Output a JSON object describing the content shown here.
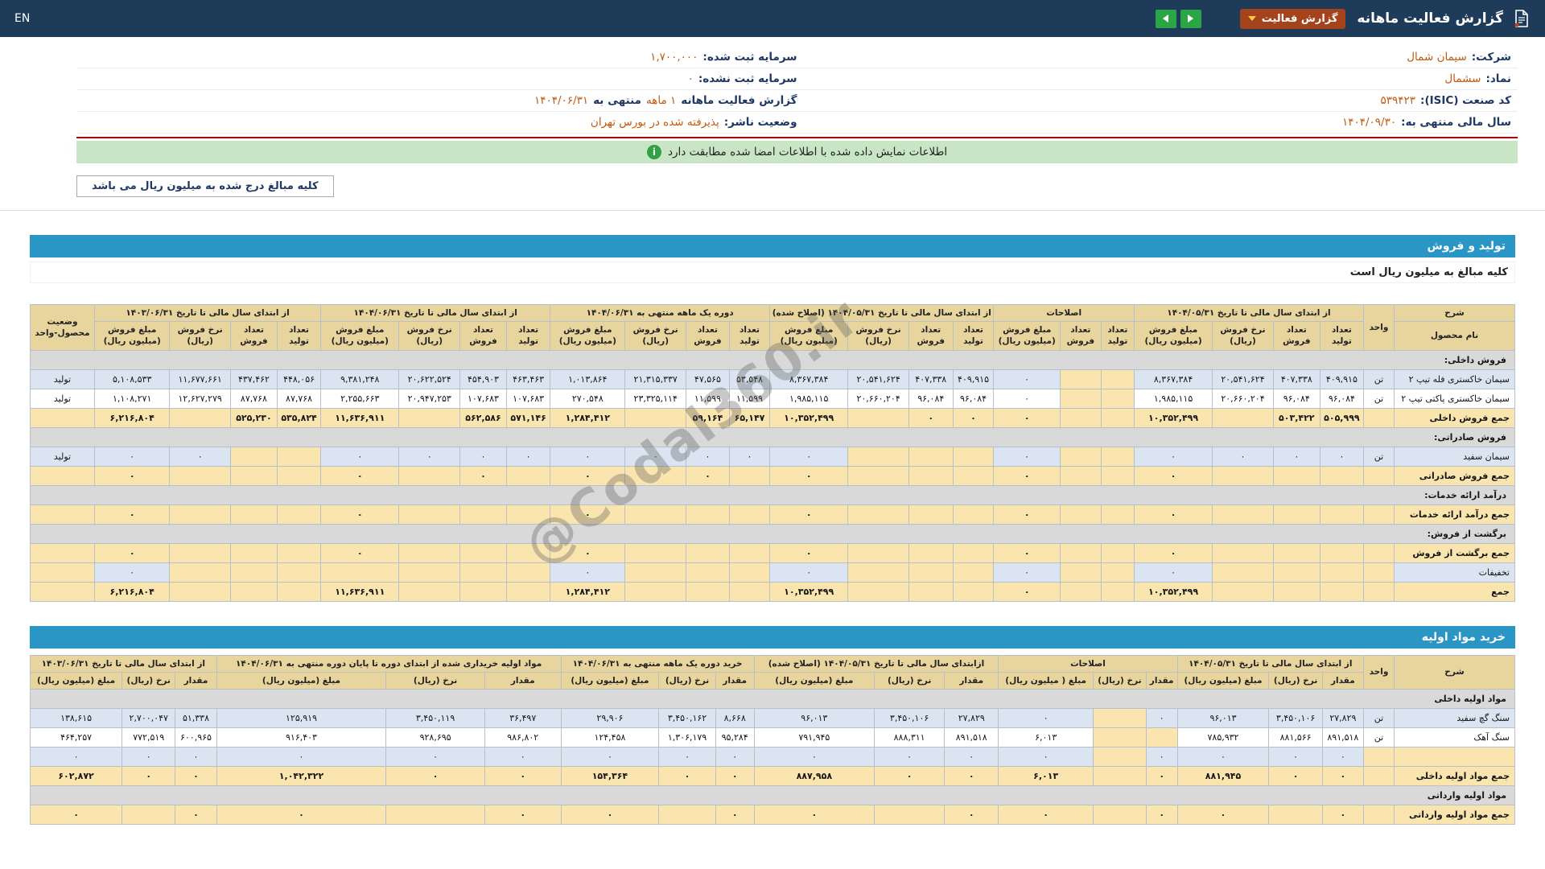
{
  "navbar": {
    "title": "گزارش فعالیت ماهانه",
    "report_type": "گزارش فعالیت",
    "lang": "EN"
  },
  "info": {
    "rows": [
      {
        "r_label": "شرکت:",
        "r_value": "سیمان شمال",
        "l_label": "سرمایه ثبت شده:",
        "l_value": "۱,۷۰۰,۰۰۰"
      },
      {
        "r_label": "نماد:",
        "r_value": "سشمال",
        "l_label": "سرمایه ثبت نشده:",
        "l_value": "۰"
      },
      {
        "r_label": "کد صنعت (ISIC):",
        "r_value": "۵۳۹۴۲۳",
        "l_label": "گزارش فعالیت ماهانه",
        "l_value": "۱ ماهه",
        "l_label2": "منتهی به",
        "l_value2": "۱۴۰۴/۰۶/۳۱"
      },
      {
        "r_label": "سال مالی منتهی به:",
        "r_value": "۱۴۰۴/۰۹/۳۰",
        "l_label": "وضعیت ناشر:",
        "l_value": "پذیرفته شده در بورس تهران"
      }
    ]
  },
  "notice": {
    "icon_glyph": "i",
    "text": "اطلاعات نمایش داده شده با اطلاعات امضا شده مطابقت دارد"
  },
  "amounts_note": "کلیه مبالغ درج شده به میلیون ریال می باشد",
  "watermark": "@Codal360.ir",
  "colors": {
    "navbar_bg": "#1e3c5a",
    "badge_bg": "#a5431c",
    "caret_yellow": "#ffc83d",
    "arrow_green": "#2aa744",
    "value_orange": "#c05a11",
    "label_navy": "#1f3864",
    "red_line": "#b30000",
    "notice_green": "#c8e6c5",
    "section_bar_blue": "#2a96c6",
    "table_header_tan": "#e8d59d",
    "sum_row_tan": "#fbe5af",
    "row_blue": "#dbe5f1",
    "section_row_gray": "#d9d9d9"
  },
  "production": {
    "bar": "تولید و فروش",
    "note": "کلیه مبالغ به میلیون ریال است",
    "table": {
      "data_name": "production-sales-table",
      "header": {
        "sharh": "شرح",
        "product": "نام محصول",
        "unit": "واحد",
        "status": "وضعیت محصول-واحد",
        "groups": [
          {
            "title": "از ابتدای سال مالی تا تاریخ ۱۴۰۴/۰۵/۳۱",
            "cols": [
              "تعداد تولید",
              "تعداد فروش",
              "نرخ فروش (ریال)",
              "مبلغ فروش (میلیون ریال)"
            ]
          },
          {
            "title": "اصلاحات",
            "cols": [
              "تعداد تولید",
              "تعداد فروش",
              "مبلغ فروش (میلیون ریال)"
            ]
          },
          {
            "title": "از ابتدای سال مالی تا تاریخ ۱۴۰۴/۰۵/۳۱ (اصلاح شده)",
            "cols": [
              "تعداد تولید",
              "تعداد فروش",
              "نرخ فروش (ریال)",
              "مبلغ فروش (میلیون ریال)"
            ]
          },
          {
            "title": "دوره یک ماهه منتهی به ۱۴۰۴/۰۶/۳۱",
            "cols": [
              "تعداد تولید",
              "تعداد فروش",
              "نرخ فروش (ریال)",
              "مبلغ فروش (میلیون ریال)"
            ]
          },
          {
            "title": "از ابتدای سال مالی تا تاریخ ۱۴۰۴/۰۶/۳۱",
            "cols": [
              "تعداد تولید",
              "تعداد فروش",
              "نرخ فروش (ریال)",
              "مبلغ فروش (میلیون ریال)"
            ]
          },
          {
            "title": "از ابتدای سال مالی تا تاریخ ۱۴۰۳/۰۶/۳۱",
            "cols": [
              "تعداد تولید",
              "تعداد فروش",
              "نرخ فروش (ریال)",
              "مبلغ فروش (میلیون ریال)"
            ]
          }
        ]
      },
      "rows": [
        {
          "type": "section",
          "label": "فروش داخلی:"
        },
        {
          "type": "data",
          "style": "blue",
          "label": "سیمان خاکستری فله تیپ ۲",
          "unit": "تن",
          "status": "تولید",
          "cells": [
            "۴۰۹,۹۱۵",
            "۴۰۷,۳۳۸",
            "۲۰,۵۴۱,۶۲۴",
            "۸,۳۶۷,۳۸۴",
            "",
            "",
            "۰",
            "۴۰۹,۹۱۵",
            "۴۰۷,۳۳۸",
            "۲۰,۵۴۱,۶۲۴",
            "۸,۳۶۷,۳۸۴",
            "۵۳,۵۴۸",
            "۴۷,۵۶۵",
            "۲۱,۳۱۵,۳۳۷",
            "۱,۰۱۳,۸۶۴",
            "۴۶۳,۴۶۳",
            "۴۵۴,۹۰۳",
            "۲۰,۶۲۲,۵۲۴",
            "۹,۳۸۱,۲۴۸",
            "۴۴۸,۰۵۶",
            "۴۳۷,۴۶۲",
            "۱۱,۶۷۷,۶۶۱",
            "۵,۱۰۸,۵۳۳"
          ]
        },
        {
          "type": "data",
          "style": "white",
          "label": "سیمان خاکستری پاکتی تیپ ۲",
          "unit": "تن",
          "status": "تولید",
          "cells": [
            "۹۶,۰۸۴",
            "۹۶,۰۸۴",
            "۲۰,۶۶۰,۲۰۴",
            "۱,۹۸۵,۱۱۵",
            "",
            "",
            "۰",
            "۹۶,۰۸۴",
            "۹۶,۰۸۴",
            "۲۰,۶۶۰,۲۰۴",
            "۱,۹۸۵,۱۱۵",
            "۱۱,۵۹۹",
            "۱۱,۵۹۹",
            "۲۳,۳۲۵,۱۱۴",
            "۲۷۰,۵۴۸",
            "۱۰۷,۶۸۳",
            "۱۰۷,۶۸۳",
            "۲۰,۹۴۷,۲۵۳",
            "۲,۲۵۵,۶۶۳",
            "۸۷,۷۶۸",
            "۸۷,۷۶۸",
            "۱۲,۶۲۷,۲۷۹",
            "۱,۱۰۸,۲۷۱"
          ]
        },
        {
          "type": "data",
          "style": "sum",
          "label": "جمع فروش داخلی",
          "unit": "",
          "status": "",
          "cells": [
            "۵۰۵,۹۹۹",
            "۵۰۳,۴۲۲",
            "",
            "۱۰,۳۵۲,۴۹۹",
            "",
            "",
            "۰",
            "۰",
            "۰",
            "",
            "۱۰,۳۵۲,۴۹۹",
            "۶۵,۱۴۷",
            "۵۹,۱۶۴",
            "",
            "۱,۲۸۴,۴۱۲",
            "۵۷۱,۱۴۶",
            "۵۶۲,۵۸۶",
            "",
            "۱۱,۶۳۶,۹۱۱",
            "۵۳۵,۸۲۴",
            "۵۲۵,۲۳۰",
            "",
            "۶,۲۱۶,۸۰۴"
          ]
        },
        {
          "type": "section",
          "label": "فروش صادراتی:"
        },
        {
          "type": "data",
          "style": "blue",
          "label": "سیمان سفید",
          "unit": "تن",
          "status": "تولید",
          "cells": [
            "۰",
            "۰",
            "۰",
            "۰",
            "",
            "",
            "۰",
            "",
            "",
            "",
            "۰",
            "۰",
            "۰",
            "۰",
            "۰",
            "۰",
            "۰",
            "۰",
            "۰",
            "",
            "",
            "۰",
            "۰"
          ]
        },
        {
          "type": "data",
          "style": "sum",
          "label": "جمع فروش صادراتی",
          "unit": "",
          "status": "",
          "cells": [
            "",
            "",
            "",
            "۰",
            "",
            "",
            "۰",
            "",
            "",
            "",
            "۰",
            "",
            "۰",
            "",
            "۰",
            "",
            "۰",
            "",
            "۰",
            "",
            "",
            "",
            "۰"
          ]
        },
        {
          "type": "section",
          "label": "درآمد ارائه خدمات:"
        },
        {
          "type": "data",
          "style": "sum",
          "label": "جمع درآمد ارائه خدمات",
          "unit": "",
          "status": "",
          "cells": [
            "",
            "",
            "",
            "۰",
            "",
            "",
            "۰",
            "",
            "",
            "",
            "۰",
            "",
            "",
            "",
            "۰",
            "",
            "",
            "",
            "۰",
            "",
            "",
            "",
            "۰"
          ]
        },
        {
          "type": "section",
          "label": "برگشت از فروش:"
        },
        {
          "type": "data",
          "style": "sum",
          "label": "جمع برگشت از فروش",
          "unit": "",
          "status": "",
          "cells": [
            "",
            "",
            "",
            "۰",
            "",
            "",
            "۰",
            "",
            "",
            "",
            "۰",
            "",
            "",
            "",
            "۰",
            "",
            "",
            "",
            "۰",
            "",
            "",
            "",
            "۰"
          ]
        },
        {
          "type": "data",
          "style": "blue",
          "label": "تخفیفات",
          "unit": "",
          "status": "",
          "cells": [
            "",
            "",
            "",
            "۰",
            "",
            "",
            "۰",
            "",
            "",
            "",
            "۰",
            "",
            "",
            "",
            "۰",
            "",
            "",
            "",
            "",
            "",
            "",
            "",
            "۰"
          ]
        },
        {
          "type": "data",
          "style": "sum",
          "label": "جمع",
          "unit": "",
          "status": "",
          "cells": [
            "",
            "",
            "",
            "۱۰,۳۵۲,۴۹۹",
            "",
            "",
            "۰",
            "",
            "",
            "",
            "۱۰,۳۵۲,۴۹۹",
            "",
            "",
            "",
            "۱,۲۸۴,۴۱۲",
            "",
            "",
            "",
            "۱۱,۶۳۶,۹۱۱",
            "",
            "",
            "",
            "۶,۲۱۶,۸۰۴"
          ]
        }
      ]
    }
  },
  "materials": {
    "bar": "خرید مواد اولیه",
    "table": {
      "data_name": "materials-purchase-table",
      "header": {
        "sharh": "شرح",
        "unit": "واحد",
        "groups": [
          {
            "title": "از ابتدای سال مالی تا تاریخ ۱۴۰۴/۰۵/۳۱",
            "cols": [
              "مقدار",
              "نرخ (ریال)",
              "مبلغ (میلیون ریال)"
            ]
          },
          {
            "title": "اصلاحات",
            "cols": [
              "مقدار",
              "نرخ (ریال)",
              "مبلغ ( میلیون ریال)"
            ]
          },
          {
            "title": "ازابتدای سال مالی تا تاریخ ۱۴۰۴/۰۵/۳۱ (اصلاح شده)",
            "cols": [
              "مقدار",
              "نرخ (ریال)",
              "مبلغ (میلیون ریال)"
            ]
          },
          {
            "title": "خرید دوره یک ماهه منتهی به ۱۴۰۴/۰۶/۳۱",
            "cols": [
              "مقدار",
              "نرخ (ریال)",
              "مبلغ (میلیون ریال)"
            ]
          },
          {
            "title": "مواد اولیه خریداری شده از ابتدای دوره تا پایان دوره منتهی به ۱۴۰۴/۰۶/۳۱",
            "cols": [
              "مقدار",
              "نرخ (ریال)",
              "مبلغ (میلیون ریال)"
            ]
          },
          {
            "title": "از ابتدای سال مالی تا تاریخ ۱۴۰۳/۰۶/۳۱",
            "cols": [
              "مقدار",
              "نرخ (ریال)",
              "مبلغ (میلیون ریال)"
            ]
          }
        ]
      },
      "rows": [
        {
          "type": "section",
          "label": "مواد اولیه داخلی"
        },
        {
          "type": "data",
          "style": "blue",
          "label": "سنگ گچ سفید",
          "unit": "تن",
          "cells": [
            "۲۷,۸۲۹",
            "۳,۴۵۰,۱۰۶",
            "۹۶,۰۱۳",
            "۰",
            "",
            "۰",
            "۲۷,۸۲۹",
            "۳,۴۵۰,۱۰۶",
            "۹۶,۰۱۳",
            "۸,۶۶۸",
            "۳,۴۵۰,۱۶۲",
            "۲۹,۹۰۶",
            "۳۶,۴۹۷",
            "۳,۴۵۰,۱۱۹",
            "۱۲۵,۹۱۹",
            "۵۱,۳۳۸",
            "۲,۷۰۰,۰۴۷",
            "۱۳۸,۶۱۵"
          ]
        },
        {
          "type": "data",
          "style": "white",
          "label": "سنگ آهک",
          "unit": "تن",
          "cells": [
            "۸۹۱,۵۱۸",
            "۸۸۱,۵۶۶",
            "۷۸۵,۹۳۲",
            "",
            "",
            "۶,۰۱۳",
            "۸۹۱,۵۱۸",
            "۸۸۸,۳۱۱",
            "۷۹۱,۹۴۵",
            "۹۵,۲۸۴",
            "۱,۳۰۶,۱۷۹",
            "۱۲۴,۴۵۸",
            "۹۸۶,۸۰۲",
            "۹۲۸,۶۹۵",
            "۹۱۶,۴۰۳",
            "۶۰۰,۹۶۵",
            "۷۷۲,۵۱۹",
            "۴۶۴,۲۵۷"
          ]
        },
        {
          "type": "data",
          "style": "blue",
          "label": "",
          "unit": "",
          "cells": [
            "۰",
            "۰",
            "۰",
            "۰",
            "",
            "۰",
            "۰",
            "۰",
            "۰",
            "۰",
            "۰",
            "۰",
            "۰",
            "۰",
            "۰",
            "۰",
            "۰",
            "۰"
          ]
        },
        {
          "type": "data",
          "style": "sum",
          "label": "جمع مواد اولیه داخلی",
          "unit": "",
          "cells": [
            "۰",
            "۰",
            "۸۸۱,۹۴۵",
            "۰",
            "",
            "۶,۰۱۳",
            "۰",
            "۰",
            "۸۸۷,۹۵۸",
            "۰",
            "۰",
            "۱۵۴,۳۶۴",
            "۰",
            "۰",
            "۱,۰۴۲,۳۲۲",
            "۰",
            "۰",
            "۶۰۲,۸۷۲"
          ]
        },
        {
          "type": "section",
          "label": "مواد اولیه وارداتی"
        },
        {
          "type": "data",
          "style": "sum",
          "label": "جمع مواد اولیه وارداتی",
          "unit": "",
          "cells": [
            "۰",
            "",
            "۰",
            "۰",
            "",
            "۰",
            "۰",
            "",
            "۰",
            "۰",
            "",
            "۰",
            "۰",
            "",
            "۰",
            "۰",
            "",
            "۰"
          ]
        }
      ]
    }
  }
}
